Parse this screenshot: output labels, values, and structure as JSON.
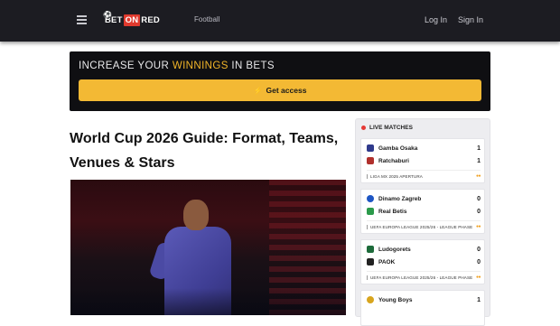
{
  "header": {
    "logo": {
      "prefix": "BET",
      "middle": "ON",
      "suffix": "RED"
    },
    "nav_football": "Football",
    "login": "Log In",
    "signin": "Sign In"
  },
  "promo": {
    "text_before": "INCREASE YOUR",
    "text_highlight": "WINNINGS",
    "text_after": "IN BETS",
    "button_label": "Get access",
    "accent_color": "#f3b934"
  },
  "article": {
    "title": "World Cup 2026 Guide: Format, Teams, Venues & Stars"
  },
  "live": {
    "heading": "LIVE MATCHES",
    "matches": [
      {
        "home": "Gamba Osaka",
        "home_score": "1",
        "away": "Ratchaburi",
        "away_score": "1",
        "league": "LIGA MX 2025 APERTURA"
      },
      {
        "home": "Dinamo Zagreb",
        "home_score": "0",
        "away": "Real Betis",
        "away_score": "0",
        "league": "UEFA EUROPA LEAGUE 2025/26 - LEAGUE PHASE"
      },
      {
        "home": "Ludogorets",
        "home_score": "0",
        "away": "PAOK",
        "away_score": "0",
        "league": "UEFA EUROPA LEAGUE 2025/26 - LEAGUE PHASE"
      },
      {
        "home": "Young Boys",
        "home_score": "1"
      }
    ]
  }
}
